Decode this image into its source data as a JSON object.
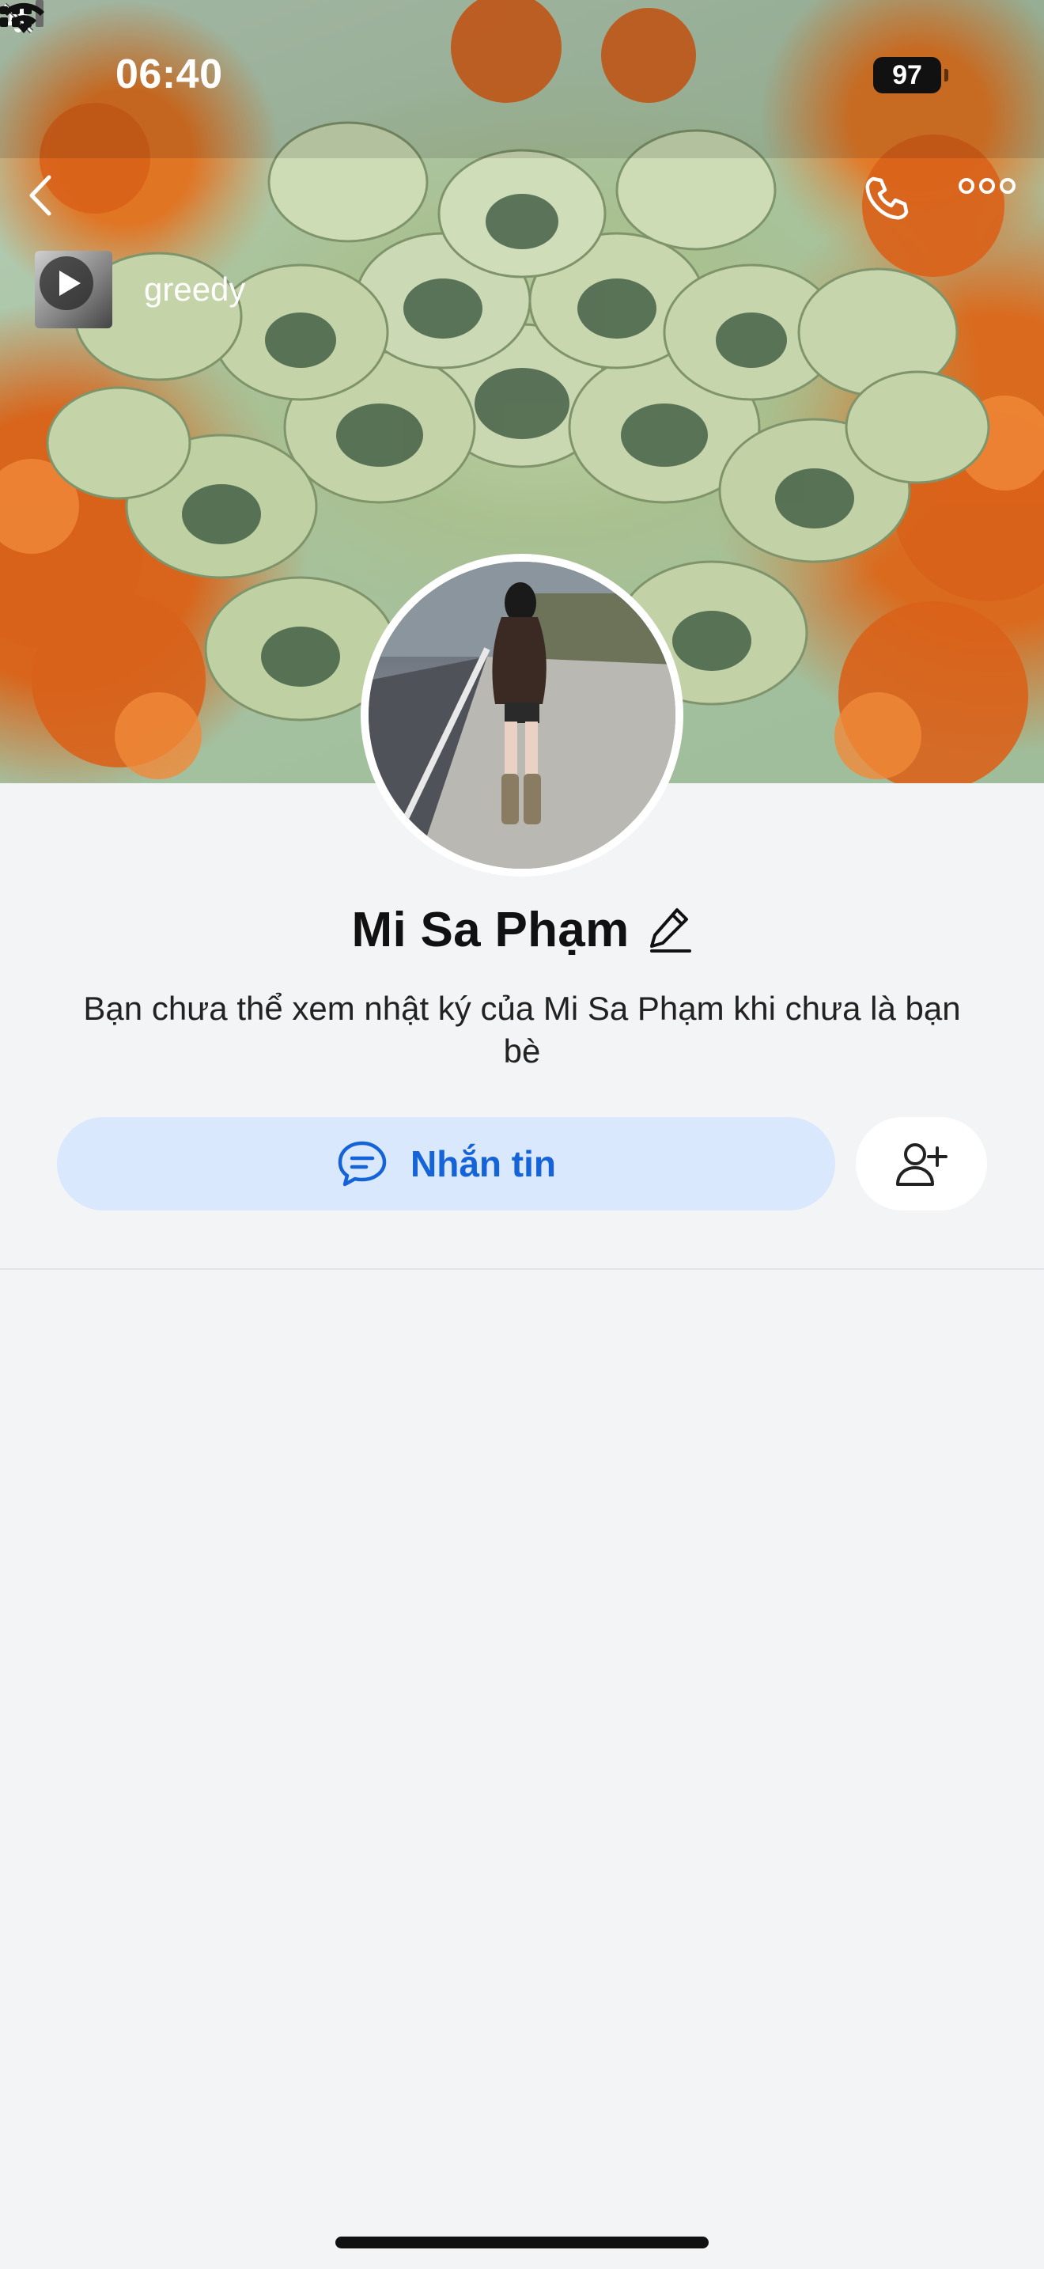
{
  "status_bar": {
    "time": "06:40",
    "battery": "97",
    "icons": [
      "bell-slash-icon",
      "cellular-signal-icon",
      "wifi-icon",
      "battery-icon"
    ]
  },
  "nav": {
    "icons": [
      "chevron-left-icon",
      "phone-icon",
      "more-horizontal-icon"
    ]
  },
  "music": {
    "label": "greedy",
    "icon": "play-icon"
  },
  "profile": {
    "name": "Mi Sa Phạm",
    "notice": "Bạn chưa thể xem nhật ký của Mi Sa Phạm khi chưa là bạn bè"
  },
  "actions": {
    "message_label": "Nhắn tin",
    "message_icon": "chat-bubble-icon",
    "add_friend_icon": "user-plus-icon"
  },
  "colors": {
    "accent": "#1463d8",
    "accent_bg": "#d9e8fd",
    "page_bg": "#f3f4f6"
  }
}
